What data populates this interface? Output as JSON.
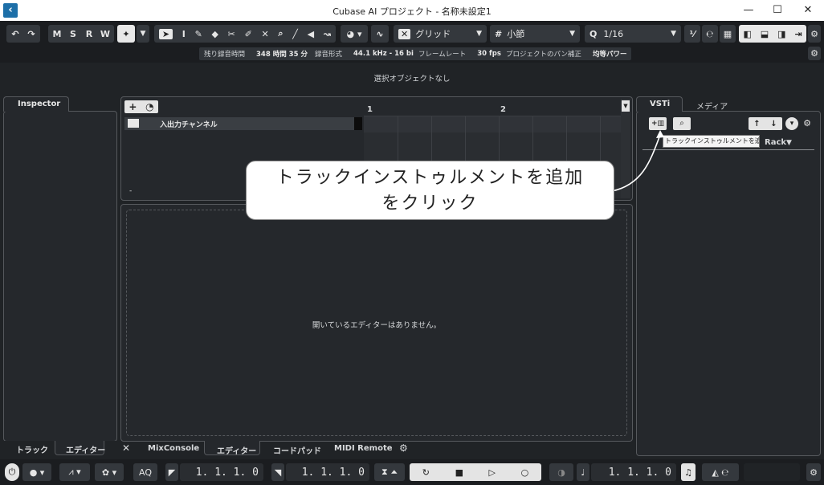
{
  "window": {
    "title": "Cubase AI プロジェクト - 名称未設定1",
    "minimize": "—",
    "maximize": "☐",
    "close": "✕"
  },
  "toolbar": {
    "undo": "↶",
    "redo": "↷",
    "m": "M",
    "s": "S",
    "r": "R",
    "w": "W",
    "snap_type": "グリッド",
    "grid_label": "小節",
    "quantize": "1/16",
    "grid_icon": "#",
    "quantize_icon": "Q"
  },
  "info": {
    "rec_time_label": "残り録音時間",
    "rec_time_value": "348 時間 35 分",
    "rec_format_label": "録音形式",
    "rec_format_value": "44.1 kHz - 16 bit",
    "framerate_label": "フレームレート",
    "framerate_value": "30 fps",
    "pan_label": "プロジェクトのパン補正",
    "pan_value": "均等パワー"
  },
  "selection_text": "選択オブジェクトなし",
  "inspector": {
    "tab": "Inspector",
    "bottom_tabs": [
      "トラック",
      "エディター"
    ]
  },
  "tracklist": {
    "add": "+",
    "track_name": "入出力チャンネル",
    "dash": "-",
    "ruler": [
      "1",
      "2"
    ]
  },
  "editor": {
    "empty_text": "開いているエディターはありません。",
    "bottom_tabs": [
      "MixConsole",
      "エディター",
      "コードパッド",
      "MIDI Remote"
    ],
    "close": "✕"
  },
  "right": {
    "tabs": [
      "VSTi",
      "メディア"
    ],
    "rack_label": "Rack",
    "tooltip": "トラックインストゥルメントを追加..."
  },
  "callout": {
    "line1": "トラックインストゥルメントを追加",
    "line2": "をクリック"
  },
  "transport": {
    "aq": "AQ",
    "left_locator": "1. 1. 1.  0",
    "right_locator": "1. 1. 1.  0",
    "position": "1. 1. 1.  0"
  },
  "colors": {
    "accent": "#1d6fa8",
    "panel_bg": "#25282c",
    "frame_bg": "#1b1d20"
  }
}
